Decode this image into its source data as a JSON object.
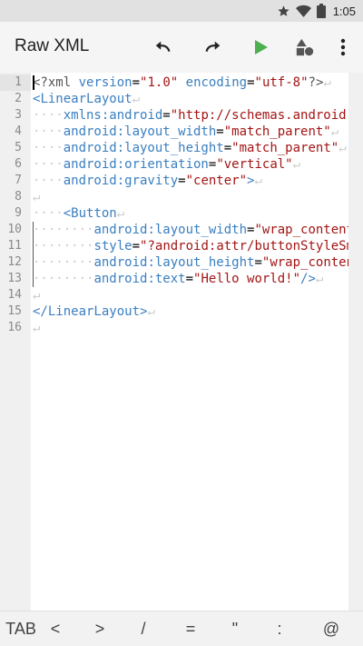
{
  "status_bar": {
    "time": "1:05"
  },
  "app_bar": {
    "title": "Raw XML",
    "icons": [
      "undo-icon",
      "redo-icon",
      "play-icon",
      "shapes-icon",
      "more-vert-icon"
    ],
    "accent": "#4caf50"
  },
  "editor": {
    "line_numbers": [
      "1",
      "2",
      "3",
      "4",
      "5",
      "6",
      "7",
      "8",
      "9",
      "10",
      "11",
      "12",
      "13",
      "14",
      "15",
      "16"
    ],
    "lines": [
      [
        {
          "t": "<?xml",
          "c": "#555555"
        },
        {
          "t": " ",
          "c": "#bbbbbb"
        },
        {
          "t": "version",
          "c": "#3a7fc1"
        },
        {
          "t": "=",
          "c": "#000000"
        },
        {
          "t": "\"1.0\"",
          "c": "#a31515"
        },
        {
          "t": " ",
          "c": "#bbbbbb"
        },
        {
          "t": "encoding",
          "c": "#3a7fc1"
        },
        {
          "t": "=",
          "c": "#000000"
        },
        {
          "t": "\"utf-8\"",
          "c": "#a31515"
        },
        {
          "t": "?>",
          "c": "#555555"
        },
        {
          "t": "↵",
          "c": "#cccccc"
        }
      ],
      [
        {
          "t": "<",
          "c": "#3a7fc1"
        },
        {
          "t": "LinearLayout",
          "c": "#3a7fc1"
        },
        {
          "t": "↵",
          "c": "#cccccc"
        }
      ],
      [
        {
          "t": "····",
          "c": "#cccccc"
        },
        {
          "t": "xmlns:android",
          "c": "#3a7fc1"
        },
        {
          "t": "=",
          "c": "#000000"
        },
        {
          "t": "\"http://schemas.android.com/apk/res/android\"",
          "c": "#a31515"
        },
        {
          "t": "↵",
          "c": "#cccccc"
        }
      ],
      [
        {
          "t": "····",
          "c": "#cccccc"
        },
        {
          "t": "android:layout_width",
          "c": "#3a7fc1"
        },
        {
          "t": "=",
          "c": "#000000"
        },
        {
          "t": "\"match_parent\"",
          "c": "#a31515"
        },
        {
          "t": "↵",
          "c": "#cccccc"
        }
      ],
      [
        {
          "t": "····",
          "c": "#cccccc"
        },
        {
          "t": "android:layout_height",
          "c": "#3a7fc1"
        },
        {
          "t": "=",
          "c": "#000000"
        },
        {
          "t": "\"match_parent\"",
          "c": "#a31515"
        },
        {
          "t": "↵",
          "c": "#cccccc"
        }
      ],
      [
        {
          "t": "····",
          "c": "#cccccc"
        },
        {
          "t": "android:orientation",
          "c": "#3a7fc1"
        },
        {
          "t": "=",
          "c": "#000000"
        },
        {
          "t": "\"vertical\"",
          "c": "#a31515"
        },
        {
          "t": "↵",
          "c": "#cccccc"
        }
      ],
      [
        {
          "t": "····",
          "c": "#cccccc"
        },
        {
          "t": "android:gravity",
          "c": "#3a7fc1"
        },
        {
          "t": "=",
          "c": "#000000"
        },
        {
          "t": "\"center\"",
          "c": "#a31515"
        },
        {
          "t": ">",
          "c": "#3a7fc1"
        },
        {
          "t": "↵",
          "c": "#cccccc"
        }
      ],
      [
        {
          "t": "↵",
          "c": "#cccccc"
        }
      ],
      [
        {
          "t": "····",
          "c": "#cccccc"
        },
        {
          "t": "<",
          "c": "#3a7fc1"
        },
        {
          "t": "Button",
          "c": "#3a7fc1"
        },
        {
          "t": "↵",
          "c": "#cccccc"
        }
      ],
      [
        {
          "t": "········",
          "c": "#cccccc"
        },
        {
          "t": "android:layout_width",
          "c": "#3a7fc1"
        },
        {
          "t": "=",
          "c": "#000000"
        },
        {
          "t": "\"wrap_content\"",
          "c": "#a31515"
        },
        {
          "t": "↵",
          "c": "#cccccc"
        }
      ],
      [
        {
          "t": "········",
          "c": "#cccccc"
        },
        {
          "t": "style",
          "c": "#3a7fc1"
        },
        {
          "t": "=",
          "c": "#000000"
        },
        {
          "t": "\"?android:attr/buttonStyleSmall\"",
          "c": "#a31515"
        },
        {
          "t": "↵",
          "c": "#cccccc"
        }
      ],
      [
        {
          "t": "········",
          "c": "#cccccc"
        },
        {
          "t": "android:layout_height",
          "c": "#3a7fc1"
        },
        {
          "t": "=",
          "c": "#000000"
        },
        {
          "t": "\"wrap_content\"",
          "c": "#a31515"
        },
        {
          "t": "↵",
          "c": "#cccccc"
        }
      ],
      [
        {
          "t": "········",
          "c": "#cccccc"
        },
        {
          "t": "android:text",
          "c": "#3a7fc1"
        },
        {
          "t": "=",
          "c": "#000000"
        },
        {
          "t": "\"Hello world!\"",
          "c": "#a31515"
        },
        {
          "t": "/>",
          "c": "#3a7fc1"
        },
        {
          "t": "↵",
          "c": "#cccccc"
        }
      ],
      [
        {
          "t": "↵",
          "c": "#cccccc"
        }
      ],
      [
        {
          "t": "</",
          "c": "#3a7fc1"
        },
        {
          "t": "LinearLayout",
          "c": "#3a7fc1"
        },
        {
          "t": ">",
          "c": "#3a7fc1"
        },
        {
          "t": "↵",
          "c": "#cccccc"
        }
      ],
      [
        {
          "t": "↵",
          "c": "#cccccc"
        }
      ]
    ]
  },
  "keybar": {
    "keys": [
      "TAB",
      "<",
      ">",
      "/",
      "=",
      "\"",
      ":",
      "@"
    ]
  }
}
